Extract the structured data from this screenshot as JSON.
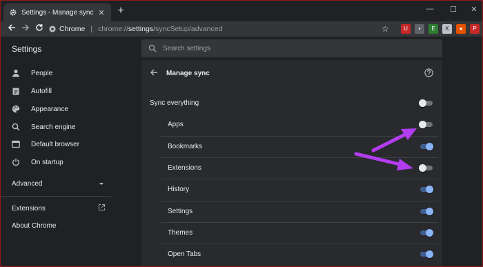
{
  "browser": {
    "tab_title": "Settings - Manage sync",
    "tab_close": "✕",
    "new_tab": "+",
    "window_controls": [
      "—",
      "☐",
      "✕"
    ],
    "origin_label": "Chrome",
    "url_scheme": "chrome://",
    "url_host": "settings",
    "url_path": "/syncSetup/advanced",
    "extensions": [
      {
        "name": "ublock-icon",
        "color": "#c62828",
        "glyph": "U"
      },
      {
        "name": "extension-gray-icon",
        "color": "#5f6368",
        "glyph": "▪"
      },
      {
        "name": "evernote-icon",
        "color": "#2e7d32",
        "glyph": "E"
      },
      {
        "name": "extension-k-icon",
        "color": "#bdc1c6",
        "glyph": "K"
      },
      {
        "name": "extension-orange-icon",
        "color": "#e65100",
        "glyph": "●"
      },
      {
        "name": "pdf-icon",
        "color": "#c62828",
        "glyph": "P"
      }
    ]
  },
  "header": {
    "title": "Settings",
    "search_placeholder": "Search settings"
  },
  "sidebar": {
    "items": [
      {
        "label": "People",
        "icon": "person-icon"
      },
      {
        "label": "Autofill",
        "icon": "clipboard-icon"
      },
      {
        "label": "Appearance",
        "icon": "palette-icon"
      },
      {
        "label": "Search engine",
        "icon": "search-icon"
      },
      {
        "label": "Default browser",
        "icon": "browser-icon"
      },
      {
        "label": "On startup",
        "icon": "power-icon"
      }
    ],
    "advanced_label": "Advanced",
    "extensions_label": "Extensions",
    "about_label": "About Chrome"
  },
  "manage_sync": {
    "title": "Manage sync",
    "sync_everything": {
      "label": "Sync everything",
      "enabled": false
    },
    "items": [
      {
        "label": "Apps",
        "enabled": false
      },
      {
        "label": "Bookmarks",
        "enabled": true
      },
      {
        "label": "Extensions",
        "enabled": false
      },
      {
        "label": "History",
        "enabled": true
      },
      {
        "label": "Settings",
        "enabled": true
      },
      {
        "label": "Themes",
        "enabled": true
      },
      {
        "label": "Open Tabs",
        "enabled": true
      }
    ]
  },
  "colors": {
    "background": "#202124",
    "card": "#292a2d",
    "toggle_on": "#8ab4f8",
    "toggle_off": "#e8eaed",
    "annotation_arrow": "#b33df2"
  }
}
